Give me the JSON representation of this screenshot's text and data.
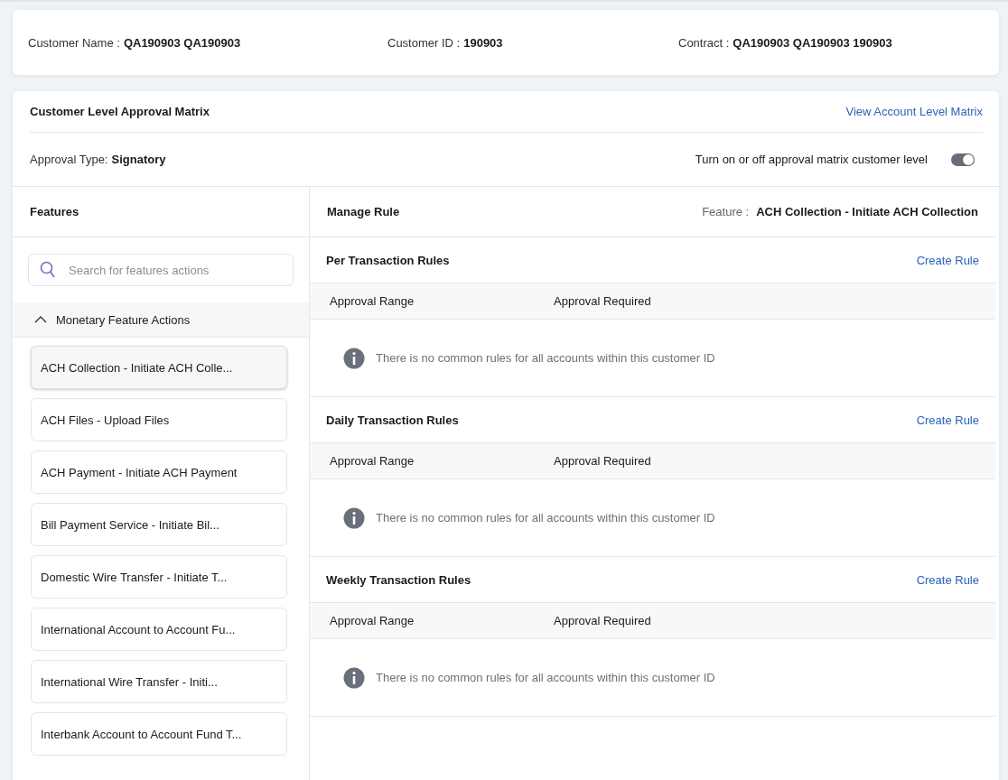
{
  "customer_info": [
    {
      "label": "Customer Name :",
      "value": "QA190903 QA190903"
    },
    {
      "label": "Customer ID :",
      "value": "190903"
    },
    {
      "label": "Contract :",
      "value": "QA190903 QA190903 190903"
    }
  ],
  "matrix": {
    "title": "Customer Level Approval Matrix",
    "link": "View Account Level Matrix",
    "approval_type_label": "Approval Type:",
    "approval_type": "Signatory",
    "toggle_label": "Turn on or off approval matrix customer level",
    "toggle_on": true
  },
  "features": {
    "title": "Features",
    "search": {
      "placeholder": "Search for features actions"
    },
    "group": {
      "label": "Monetary Feature Actions",
      "expanded": true,
      "items": [
        {
          "label": "ACH Collection - Initiate ACH Colle...",
          "selected": true
        },
        {
          "label": "ACH Files - Upload Files",
          "selected": false
        },
        {
          "label": "ACH Payment - Initiate ACH Payment",
          "selected": false
        },
        {
          "label": "Bill Payment Service - Initiate Bil...",
          "selected": false
        },
        {
          "label": "Domestic Wire Transfer - Initiate T...",
          "selected": false
        },
        {
          "label": "International Account to Account Fu...",
          "selected": false
        },
        {
          "label": "International Wire Transfer - Initi...",
          "selected": false
        },
        {
          "label": "Interbank Account to Account Fund T...",
          "selected": false
        }
      ]
    }
  },
  "manage_rule": {
    "title": "Manage Rule",
    "feature_label": "Feature :",
    "feature_value": "ACH Collection - Initiate ACH Collection",
    "sections": [
      {
        "title": "Per Transaction Rules",
        "action": "Create Rule",
        "columns": [
          "Approval Range",
          "Approval Required"
        ],
        "message": "There is no common rules for all accounts within this customer ID"
      },
      {
        "title": "Daily Transaction Rules",
        "action": "Create Rule",
        "columns": [
          "Approval Range",
          "Approval Required"
        ],
        "message": "There is no common rules for all accounts within this customer ID"
      },
      {
        "title": "Weekly Transaction Rules",
        "action": "Create Rule",
        "columns": [
          "Approval Range",
          "Approval Required"
        ],
        "message": "There is no common rules for all accounts within this customer ID"
      }
    ]
  }
}
